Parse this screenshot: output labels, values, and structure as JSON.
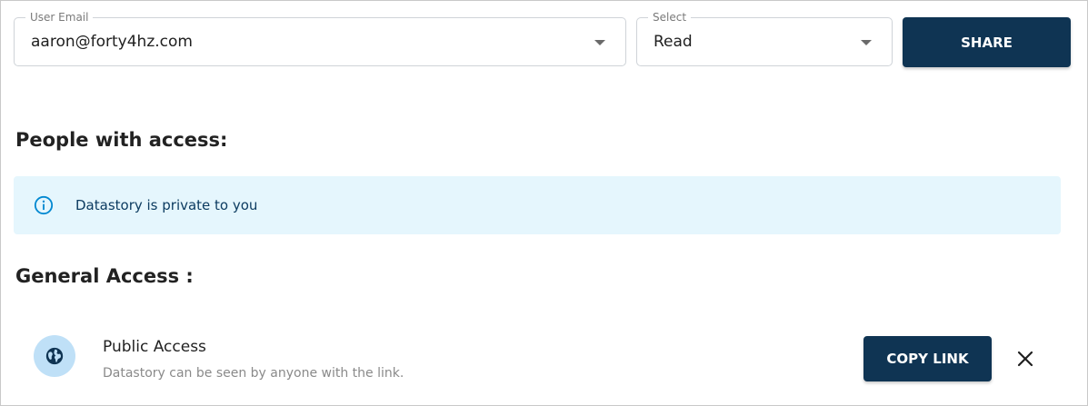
{
  "email_field": {
    "legend": "User Email",
    "value": "aaron@forty4hz.com"
  },
  "permission_field": {
    "legend": "Select",
    "value": "Read"
  },
  "share_button": {
    "label": "SHARE"
  },
  "people_section": {
    "title": "People with access:"
  },
  "alert": {
    "icon": "info-icon",
    "message": "Datastory is private to you"
  },
  "general_section": {
    "title": "General Access :"
  },
  "public_access": {
    "icon": "globe-icon",
    "title": "Public Access",
    "description": "Datastory can be seen by anyone with the link.",
    "copy_label": "COPY LINK",
    "close_icon": "close-icon"
  },
  "colors": {
    "primary": "#0f3453",
    "alert_bg": "#e5f6fd",
    "info": "#0288d1",
    "avatar_bg": "#bfe0f7"
  }
}
